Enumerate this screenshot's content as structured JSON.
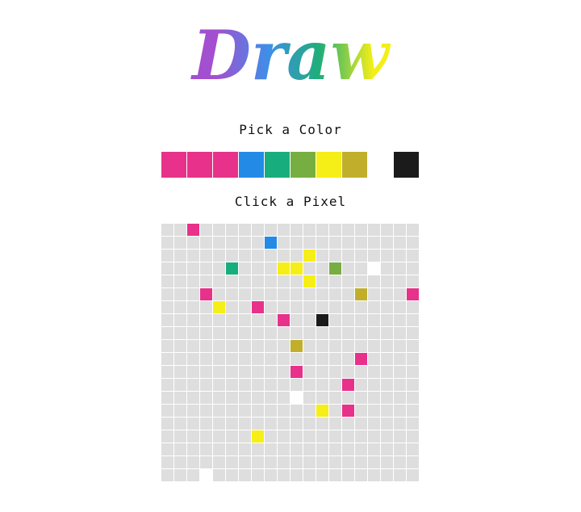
{
  "app": {
    "title": "Draw",
    "title_gradient": [
      "#a24fd0",
      "#3f8ee8",
      "#1fae79",
      "#f3ee18"
    ]
  },
  "palette": {
    "heading": "Pick a Color",
    "swatches": [
      {
        "name": "pink-1",
        "color": "#e8318a"
      },
      {
        "name": "pink-2",
        "color": "#e8318a"
      },
      {
        "name": "pink-3",
        "color": "#e8318a"
      },
      {
        "name": "blue",
        "color": "#238be6"
      },
      {
        "name": "green",
        "color": "#18ad7c"
      },
      {
        "name": "olive-green",
        "color": "#77ae42"
      },
      {
        "name": "yellow",
        "color": "#f6ee17"
      },
      {
        "name": "mustard",
        "color": "#c1af2c"
      },
      {
        "name": "white",
        "color": "#ffffff"
      },
      {
        "name": "black",
        "color": "#1c1b1b"
      }
    ]
  },
  "canvas": {
    "heading": "Click a Pixel",
    "rows": 20,
    "cols": 20,
    "empty_color": "#dedede",
    "painted": [
      {
        "row": 0,
        "col": 2,
        "color": "#e8318a"
      },
      {
        "row": 1,
        "col": 8,
        "color": "#238be6"
      },
      {
        "row": 2,
        "col": 11,
        "color": "#f6ee17"
      },
      {
        "row": 3,
        "col": 5,
        "color": "#18ad7c"
      },
      {
        "row": 3,
        "col": 9,
        "color": "#f6ee17"
      },
      {
        "row": 3,
        "col": 10,
        "color": "#f6ee17"
      },
      {
        "row": 3,
        "col": 13,
        "color": "#77ae42"
      },
      {
        "row": 3,
        "col": 16,
        "color": "#ffffff"
      },
      {
        "row": 4,
        "col": 11,
        "color": "#f6ee17"
      },
      {
        "row": 5,
        "col": 3,
        "color": "#e8318a"
      },
      {
        "row": 5,
        "col": 15,
        "color": "#c1af2c"
      },
      {
        "row": 5,
        "col": 19,
        "color": "#e8318a"
      },
      {
        "row": 6,
        "col": 4,
        "color": "#f6ee17"
      },
      {
        "row": 6,
        "col": 7,
        "color": "#e8318a"
      },
      {
        "row": 7,
        "col": 9,
        "color": "#e8318a"
      },
      {
        "row": 7,
        "col": 12,
        "color": "#1c1b1b"
      },
      {
        "row": 9,
        "col": 10,
        "color": "#c1af2c"
      },
      {
        "row": 10,
        "col": 15,
        "color": "#e8318a"
      },
      {
        "row": 11,
        "col": 10,
        "color": "#e8318a"
      },
      {
        "row": 12,
        "col": 14,
        "color": "#e8318a"
      },
      {
        "row": 13,
        "col": 10,
        "color": "#ffffff"
      },
      {
        "row": 14,
        "col": 12,
        "color": "#f6ee17"
      },
      {
        "row": 14,
        "col": 14,
        "color": "#e8318a"
      },
      {
        "row": 16,
        "col": 7,
        "color": "#f6ee17"
      },
      {
        "row": 19,
        "col": 3,
        "color": "#ffffff"
      }
    ]
  }
}
